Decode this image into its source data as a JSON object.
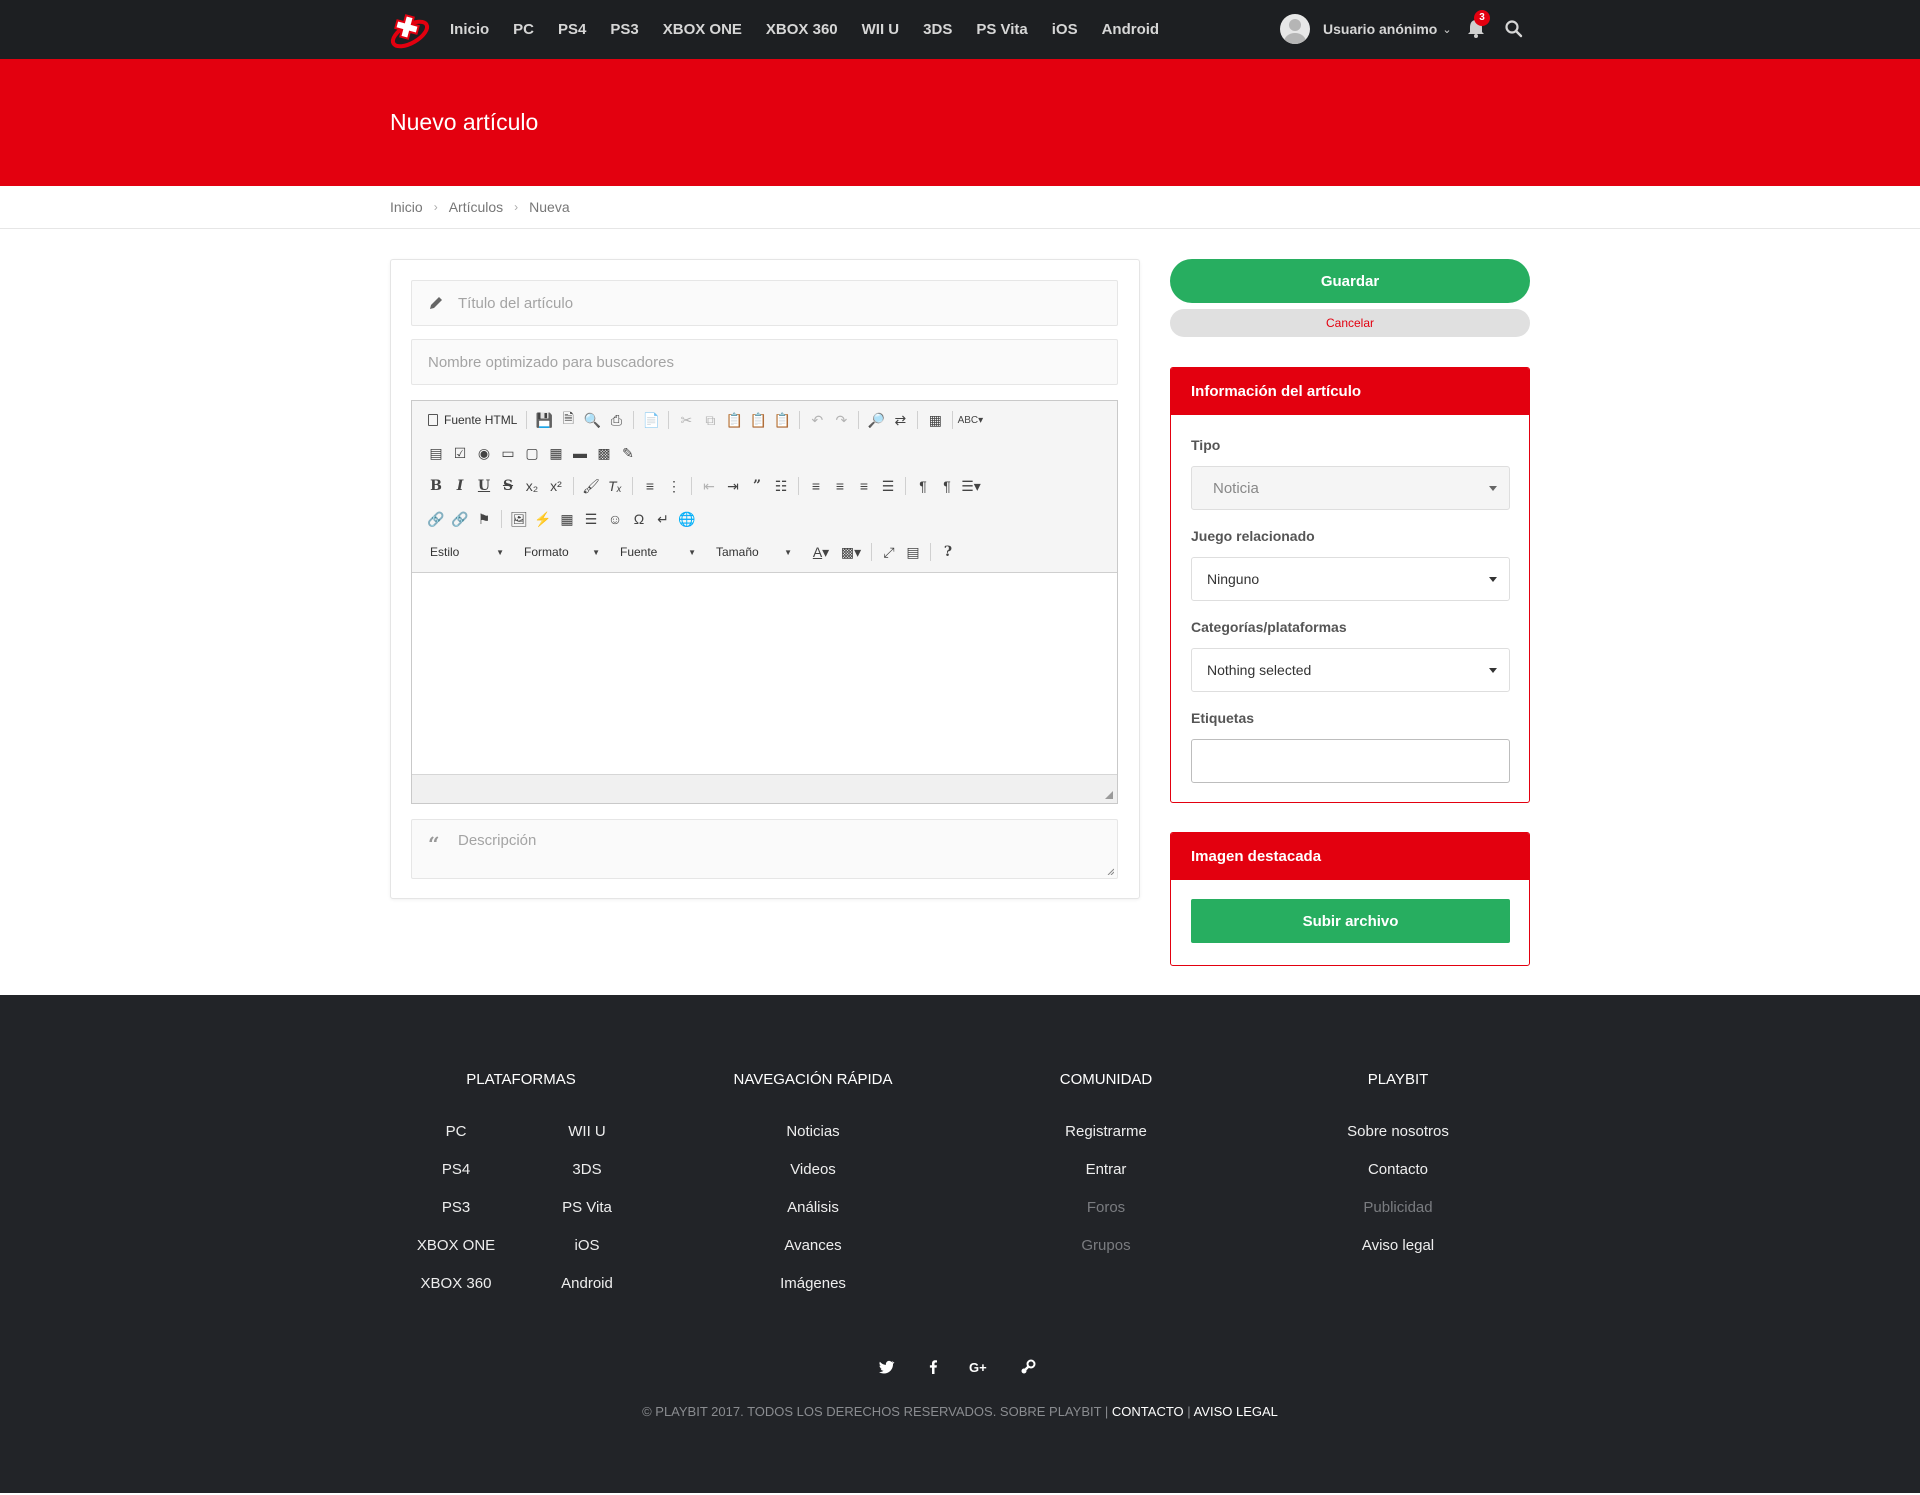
{
  "nav": {
    "links": [
      "Inicio",
      "PC",
      "PS4",
      "PS3",
      "XBOX ONE",
      "XBOX 360",
      "WII U",
      "3DS",
      "PS Vita",
      "iOS",
      "Android"
    ],
    "user": "Usuario anónimo",
    "notifications": "3"
  },
  "page": {
    "title": "Nuevo artículo",
    "breadcrumb": [
      "Inicio",
      "Artículos",
      "Nueva"
    ]
  },
  "form": {
    "title_placeholder": "Título del artículo",
    "seo_placeholder": "Nombre optimizado para buscadores",
    "description_placeholder": "Descripción",
    "editor": {
      "source_label": "Fuente HTML",
      "combos": [
        "Estilo",
        "Formato",
        "Fuente",
        "Tamaño"
      ]
    }
  },
  "sidebar": {
    "save": "Guardar",
    "cancel": "Cancelar",
    "info": {
      "heading": "Información del artículo",
      "tipo_label": "Tipo",
      "tipo_value": "Noticia",
      "juego_label": "Juego relacionado",
      "juego_value": "Ninguno",
      "cat_label": "Categorías/plataformas",
      "cat_value": "Nothing selected",
      "tags_label": "Etiquetas"
    },
    "image": {
      "heading": "Imagen destacada",
      "upload": "Subir archivo"
    }
  },
  "footer": {
    "plataformas": {
      "title": "PLATAFORMAS",
      "col1": [
        "PC",
        "PS4",
        "PS3",
        "XBOX ONE",
        "XBOX 360"
      ],
      "col2": [
        "WII U",
        "3DS",
        "PS Vita",
        "iOS",
        "Android"
      ]
    },
    "navegacion": {
      "title": "NAVEGACIÓN RÁPIDA",
      "links": [
        "Noticias",
        "Videos",
        "Análisis",
        "Avances",
        "Imágenes"
      ]
    },
    "comunidad": {
      "title": "COMUNIDAD",
      "links": [
        "Registrarme",
        "Entrar",
        "Foros",
        "Grupos"
      ]
    },
    "playbit": {
      "title": "PLAYBIT",
      "links": [
        "Sobre nosotros",
        "Contacto",
        "Publicidad",
        "Aviso legal"
      ]
    },
    "social_icons": [
      "twitter-icon",
      "facebook-icon",
      "google-plus-icon",
      "steam-icon"
    ],
    "copyright": "© PLAYBIT 2017. TODOS LOS DERECHOS RESERVADOS. SOBRE PLAYBIT |",
    "contacto": "CONTACTO",
    "sep": "|",
    "aviso": "AVISO LEGAL"
  },
  "colors": {
    "brand_red": "#e3000f",
    "green": "#27ae60",
    "topbar": "#1d1f22",
    "footer": "#222428"
  }
}
